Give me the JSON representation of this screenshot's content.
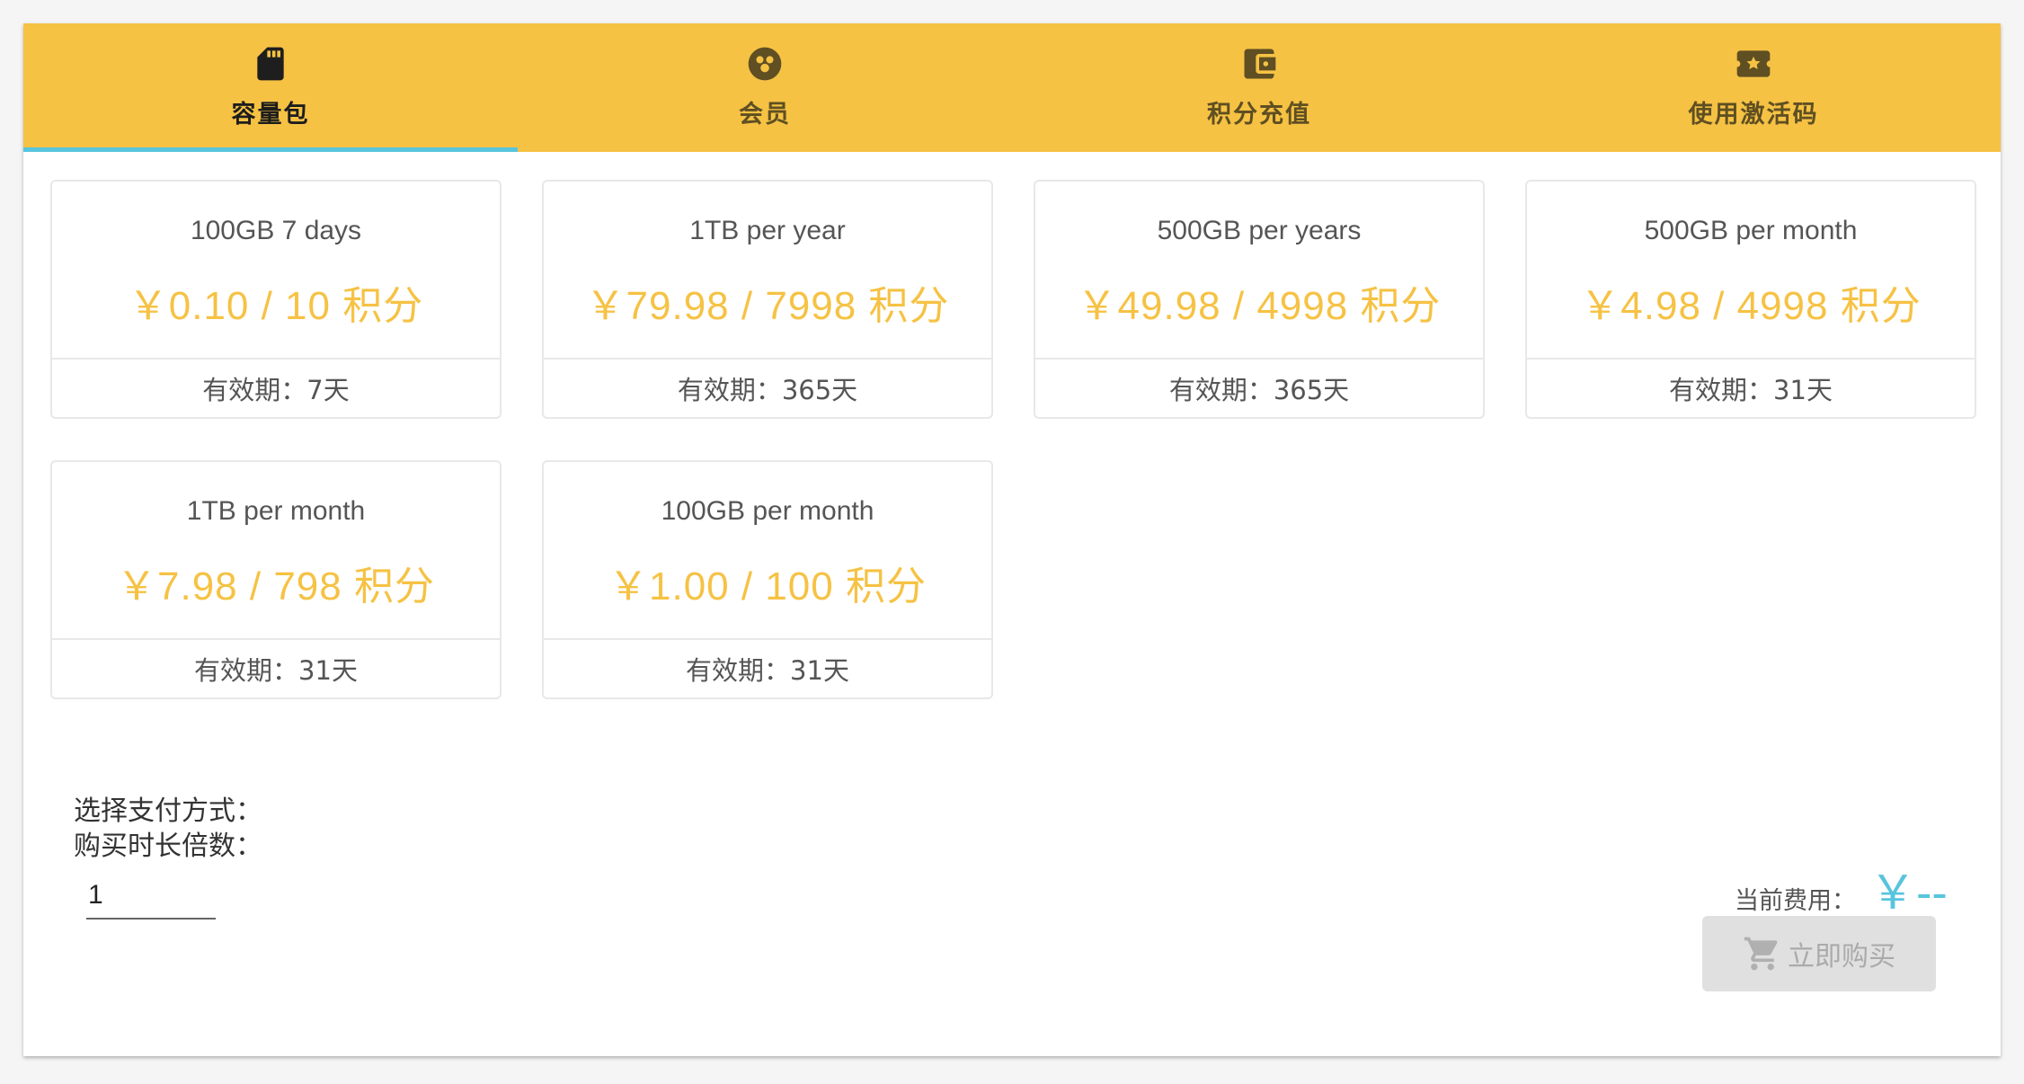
{
  "tabs": [
    {
      "label": "容量包",
      "icon": "sd-card-icon",
      "active": true
    },
    {
      "label": "会员",
      "icon": "group-icon",
      "active": false
    },
    {
      "label": "积分充值",
      "icon": "wallet-icon",
      "active": false
    },
    {
      "label": "使用激活码",
      "icon": "ticket-star-icon",
      "active": false
    }
  ],
  "packages": [
    {
      "name": "100GB 7 days",
      "price": "￥0.10 / 10 积分",
      "validity": "有效期：7天"
    },
    {
      "name": "1TB per year",
      "price": "￥79.98 / 7998 积分",
      "validity": "有效期：365天"
    },
    {
      "name": "500GB per years",
      "price": "￥49.98 / 4998 积分",
      "validity": "有效期：365天"
    },
    {
      "name": "500GB per month",
      "price": "￥4.98 / 4998 积分",
      "validity": "有效期：31天"
    },
    {
      "name": "1TB per month",
      "price": "￥7.98 / 798 积分",
      "validity": "有效期：31天"
    },
    {
      "name": "100GB per month",
      "price": "￥1.00 / 100 积分",
      "validity": "有效期：31天"
    }
  ],
  "payment": {
    "method_label": "选择支付方式：",
    "multiplier_label": "购买时长倍数：",
    "multiplier_value": "1"
  },
  "summary": {
    "cost_label": "当前费用：",
    "cost_value": "￥--",
    "buy_label": "立即购买",
    "buy_icon": "cart-icon"
  },
  "colors": {
    "accent": "#f6c244",
    "active_indicator": "#58c4dd",
    "cost": "#58c4dd",
    "disabled_button": "#e0e0e0"
  }
}
